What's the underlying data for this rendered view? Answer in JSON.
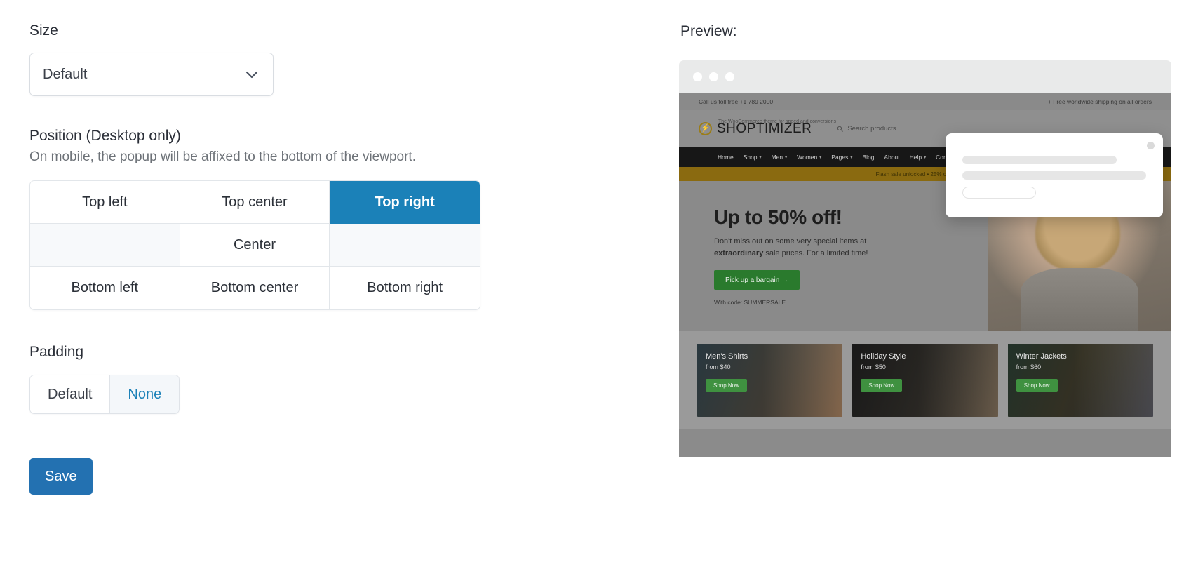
{
  "settings": {
    "size": {
      "label": "Size",
      "selected": "Default",
      "chevron_icon": "chevron-down-icon"
    },
    "position": {
      "label": "Position (Desktop only)",
      "help": "On mobile, the popup will be affixed to the bottom of the viewport.",
      "cells": [
        {
          "label": "Top left",
          "state": "normal"
        },
        {
          "label": "Top center",
          "state": "normal"
        },
        {
          "label": "Top right",
          "state": "selected"
        },
        {
          "label": "",
          "state": "empty"
        },
        {
          "label": "Center",
          "state": "normal"
        },
        {
          "label": "",
          "state": "empty"
        },
        {
          "label": "Bottom left",
          "state": "normal"
        },
        {
          "label": "Bottom center",
          "state": "normal"
        },
        {
          "label": "Bottom right",
          "state": "normal"
        }
      ],
      "selected_value": "Top right",
      "selected_color": "#1b81b8"
    },
    "padding": {
      "label": "Padding",
      "options": [
        {
          "label": "Default",
          "active": false
        },
        {
          "label": "None",
          "active": true
        }
      ],
      "selected_value": "None",
      "active_color": "#1b81b8"
    },
    "save_label": "Save",
    "save_color": "#2371b1"
  },
  "preview": {
    "title": "Preview:",
    "browser": {
      "dots": [
        "red-dot",
        "yellow-dot",
        "green-dot"
      ]
    },
    "site": {
      "topbar": {
        "left": "Call us toll free +1 789 2000",
        "right": "+ Free worldwide shipping on all orders"
      },
      "logo": {
        "icon": "lightning-bolt-icon",
        "text": "SHOPTIMIZER",
        "tagline": "The WooCommerce theme for speed and conversions",
        "accent": "#9b7d18"
      },
      "search_placeholder": "Search products...",
      "nav": [
        {
          "label": "Home",
          "caret": false
        },
        {
          "label": "Shop",
          "caret": true
        },
        {
          "label": "Men",
          "caret": true
        },
        {
          "label": "Women",
          "caret": true
        },
        {
          "label": "Pages",
          "caret": true
        },
        {
          "label": "Blog",
          "caret": false
        },
        {
          "label": "About",
          "caret": false
        },
        {
          "label": "Help",
          "caret": true
        },
        {
          "label": "Contact",
          "caret": false
        }
      ],
      "flash_bar": "Flash sale unlocked  •  25% off with code",
      "hero": {
        "title": "Up to 50% off!",
        "line1": "Don't miss out on some very special items at",
        "line2_bold": "extraordinary",
        "line2_rest": " sale prices. For a limited time!",
        "button": "Pick up a bargain →",
        "code": "With code: SUMMERSALE",
        "button_color": "#2a7a2d"
      },
      "cards": [
        {
          "title": "Men's Shirts",
          "price": "from $40",
          "button": "Shop Now"
        },
        {
          "title": "Holiday Style",
          "price": "from $50",
          "button": "Shop Now"
        },
        {
          "title": "Winter Jackets",
          "price": "from $60",
          "button": "Shop Now"
        }
      ]
    },
    "popup": {
      "close_icon": "close-dot-icon",
      "skeleton_lines": 3
    }
  }
}
